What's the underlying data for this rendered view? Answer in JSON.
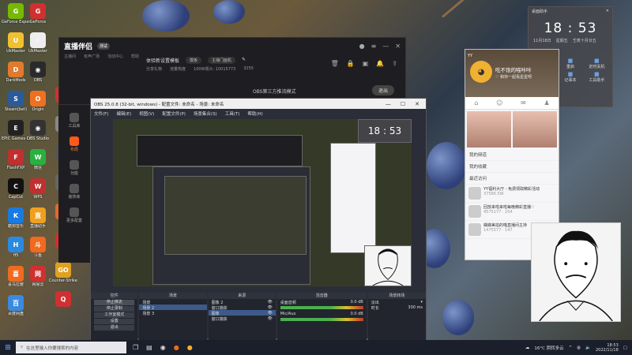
{
  "desktop": {
    "col1": [
      {
        "label": "GeForce Experience",
        "icon": "G",
        "color": "#76b900"
      },
      {
        "label": "UkMaster",
        "icon": "U",
        "color": "#f0c030"
      },
      {
        "label": "DarkMods",
        "icon": "D",
        "color": "#e07a30"
      },
      {
        "label": "Steam(bet)",
        "icon": "S",
        "color": "#2a5a9a"
      },
      {
        "label": "EPIC Games Launcher",
        "icon": "E",
        "color": "#222"
      },
      {
        "label": "FlashFXP",
        "icon": "F",
        "color": "#c03030"
      },
      {
        "label": "CapCut",
        "icon": "C",
        "color": "#111"
      },
      {
        "label": "酷狗音乐",
        "icon": "K",
        "color": "#1a7ae0"
      },
      {
        "label": "H5",
        "icon": "H",
        "color": "#2a8ae0"
      },
      {
        "label": "喜马拉雅",
        "icon": "喜",
        "color": "#f06a20"
      },
      {
        "label": "百度网盘",
        "icon": "百",
        "color": "#3a8ae0"
      }
    ],
    "col2": [
      {
        "label": "GeForce",
        "icon": "G",
        "color": "#d03030"
      },
      {
        "label": "UkMaster",
        "icon": "⚡",
        "color": "#eee"
      },
      {
        "label": "OBS",
        "icon": "◉",
        "color": "#2a2a2a"
      },
      {
        "label": "Origin",
        "icon": "O",
        "color": "#f07020"
      },
      {
        "label": "OBS Studio",
        "icon": "◉",
        "color": "#333"
      },
      {
        "label": "微信",
        "icon": "W",
        "color": "#2ab040"
      },
      {
        "label": "WPS",
        "icon": "W",
        "color": "#c03030"
      },
      {
        "label": "直播助手",
        "icon": "直",
        "color": "#f0a020"
      },
      {
        "label": "斗鱼",
        "icon": "斗",
        "color": "#f06a20"
      },
      {
        "label": "网易云",
        "icon": "网",
        "color": "#d03030"
      }
    ],
    "col3": [
      {
        "label": "",
        "icon": "F",
        "color": "#d03030"
      },
      {
        "label": "",
        "icon": "≡",
        "color": "#888"
      },
      {
        "label": "",
        "icon": "X",
        "color": "#555"
      },
      {
        "label": "",
        "icon": "□",
        "color": "#666"
      },
      {
        "label": "",
        "icon": "O",
        "color": "#e06a30"
      },
      {
        "label": "",
        "icon": "G",
        "color": "#d03030"
      },
      {
        "label": "Counter-Strike Global",
        "icon": "GO",
        "color": "#e0a020"
      },
      {
        "label": "",
        "icon": "Q",
        "color": "#d03030"
      }
    ]
  },
  "douyu": {
    "logo": "直播伴侣",
    "version": "测试",
    "menu": [
      "主播间",
      "有声广场",
      "活动中心",
      "帮助"
    ],
    "room_title": "体验新设置模板",
    "room_tag": "模板",
    "room_btn": "主播门面机",
    "stats": [
      "分享礼物",
      "流量热度",
      "100W观众: 10015773",
      "3255"
    ],
    "mode": "OBS第三方推流模式",
    "exit": "退出",
    "side": [
      {
        "label": "工具库",
        "active": false
      },
      {
        "label": "布局",
        "active": true
      },
      {
        "label": "功能",
        "active": false
      },
      {
        "label": "装饰库",
        "active": false
      },
      {
        "label": "更多配置",
        "active": false
      }
    ]
  },
  "obs": {
    "title": "OBS 25.0.8 (32-bit, windows) - 配置文件: 未命名 - 场景: 未命名",
    "menu": [
      "文件(F)",
      "编辑(E)",
      "视图(V)",
      "配置文件(P)",
      "场景集合(S)",
      "工具(T)",
      "帮助(H)"
    ],
    "docks": {
      "controls_title": "控件",
      "controls": [
        {
          "label": "停止推流",
          "hl": true
        },
        {
          "label": "停止录制",
          "hl": false
        },
        {
          "label": "工作室模式",
          "hl": false
        },
        {
          "label": "设置",
          "hl": false
        },
        {
          "label": "退出",
          "hl": false
        }
      ],
      "scenes_title": "场景",
      "scenes": [
        {
          "name": "场景",
          "sel": false
        },
        {
          "name": "场景 2",
          "sel": true
        },
        {
          "name": "场景 3",
          "sel": false
        }
      ],
      "sources_title": "来源",
      "sources": [
        {
          "name": "图像 2",
          "sel": false
        },
        {
          "name": "窗口捕获",
          "sel": false
        },
        {
          "name": "图像",
          "sel": true
        },
        {
          "name": "窗口捕获",
          "sel": false
        }
      ],
      "mixer_title": "混音器",
      "mixer": [
        {
          "name": "桌面音频",
          "db": "0.0 dB"
        },
        {
          "name": "Mic/Aux",
          "db": "0.0 dB"
        }
      ],
      "transitions_title": "场景转场",
      "transition": "淡出",
      "duration_label": "时长",
      "duration": "300 ms"
    }
  },
  "clock": {
    "header": "桌面助手",
    "time": "18 : 53",
    "date": "11月18日",
    "weekday": "星期五",
    "lunar": "壬寅十月廿五",
    "grid": [
      "关机",
      "重启",
      "定时关机",
      "锁屏",
      "记事本",
      "工具助手"
    ]
  },
  "yy": {
    "app": "YY",
    "name": "吃不饱的喵咔咔",
    "signature": "♡ 和你一起看星星呀",
    "sections": [
      "我的频道",
      "我的收藏",
      "最近访问"
    ],
    "feeds": [
      {
        "title": "YY福利大厅 - 免费领取精彩活动",
        "meta": "37586.5W"
      },
      {
        "title": "回放来啦来啦每晚精彩直播♡",
        "meta": "4575177 · 254"
      },
      {
        "title": "蝴蝶美拍的喵直播间主持",
        "meta": "1475577 · 147"
      }
    ]
  },
  "taskbar": {
    "search_placeholder": "在这里输入你要搜索的内容",
    "weather": "16°C 阴转多云",
    "time": "18:53",
    "date": "2022/11/18"
  },
  "colors": {
    "accent": "#ff5a1a",
    "obs_bg": "#2b2e38",
    "selection": "#3c5a8a"
  }
}
